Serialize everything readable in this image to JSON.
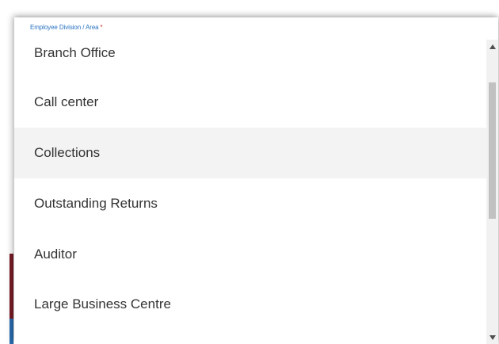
{
  "field": {
    "label": "Employee Division / Area",
    "required_marker": "*"
  },
  "dropdown": {
    "options": [
      {
        "label": "Branch Office"
      },
      {
        "label": "Call center"
      },
      {
        "label": "Collections"
      },
      {
        "label": "Outstanding Returns"
      },
      {
        "label": "Auditor"
      },
      {
        "label": "Large Business Centre"
      }
    ],
    "highlighted_option": "Collections"
  },
  "scrollbar": {
    "up_icon": "triangle-up-icon",
    "down_icon": "triangle-down-icon"
  },
  "colors": {
    "label": "#2a73c2",
    "required": "#d0342c",
    "option_text": "#333333",
    "highlight_bg": "#f3f3f3",
    "accent_red": "#7a1c27",
    "accent_blue": "#2a6db0"
  }
}
